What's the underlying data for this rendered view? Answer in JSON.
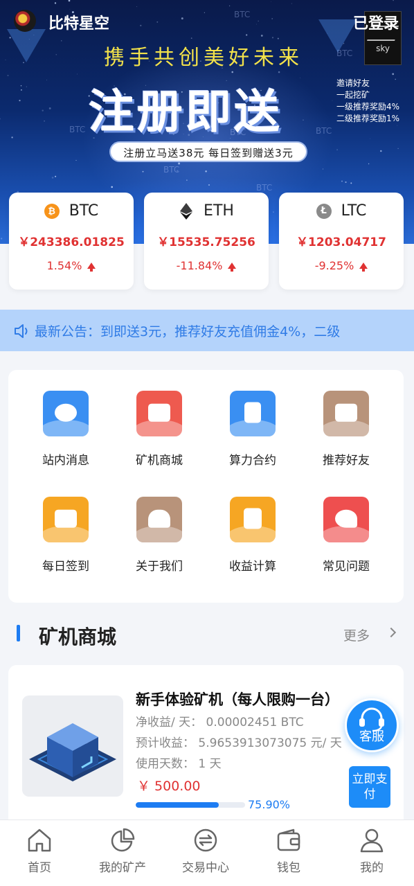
{
  "header": {
    "app_title": "比特星空",
    "login_status": "已登录",
    "avatar_caption": "sky"
  },
  "banner": {
    "slogan": "携手共创美好未来",
    "headline": "注册即送",
    "side_lines": [
      "邀请好友",
      "一起挖矿",
      "一级推荐奖励4%",
      "二级推荐奖励1%"
    ],
    "pill_text": "注册立马送38元  每日签到赠送3元",
    "watermark": "BTC"
  },
  "coins": [
    {
      "symbol": "BTC",
      "price": "￥243386.01825",
      "change": "1.54%",
      "icon": "bitcoin-icon",
      "color": "#f7931a"
    },
    {
      "symbol": "ETH",
      "price": "￥15535.75256",
      "change": "-11.84%",
      "icon": "ethereum-icon",
      "color": "#3c3c3d"
    },
    {
      "symbol": "LTC",
      "price": "￥1203.04717",
      "change": "-9.25%",
      "icon": "litecoin-icon",
      "color": "#8a8a8a"
    }
  ],
  "notice": {
    "text": "最新公告：到即送3元，推荐好友充值佣金4%，二级"
  },
  "features": [
    {
      "label": "站内消息",
      "icon": "message-icon",
      "color": "#3a8ff2"
    },
    {
      "label": "矿机商城",
      "icon": "store-icon",
      "color": "#ee5a4f"
    },
    {
      "label": "算力合约",
      "icon": "contract-icon",
      "color": "#3a8ff2"
    },
    {
      "label": "推荐好友",
      "icon": "invite-icon",
      "color": "#b8937a"
    },
    {
      "label": "每日签到",
      "icon": "checkin-icon",
      "color": "#f6a623"
    },
    {
      "label": "关于我们",
      "icon": "about-icon",
      "color": "#b8937a"
    },
    {
      "label": "收益计算",
      "icon": "calculator-icon",
      "color": "#f6a623"
    },
    {
      "label": "常见问题",
      "icon": "faq-icon",
      "color": "#ee4f4f"
    }
  ],
  "section": {
    "title": "矿机商城",
    "more": "更多"
  },
  "product": {
    "name": "新手体验矿机（每人限购一台）",
    "net_income": "净收益/ 天： 0.00002451 BTC",
    "expected_income": "预计收益： 5.9653913073075 元/ 天",
    "days": "使用天数： 1 天",
    "price": "￥ 500.00",
    "progress_percent": 75.9,
    "progress_label": "75.90%",
    "pay_button": "立即支付"
  },
  "service_button": "客服",
  "nav": [
    {
      "label": "首页",
      "icon": "home-icon"
    },
    {
      "label": "我的矿产",
      "icon": "pie-chart-icon"
    },
    {
      "label": "交易中心",
      "icon": "exchange-icon"
    },
    {
      "label": "钱包",
      "icon": "wallet-icon"
    },
    {
      "label": "我的",
      "icon": "user-icon"
    }
  ]
}
